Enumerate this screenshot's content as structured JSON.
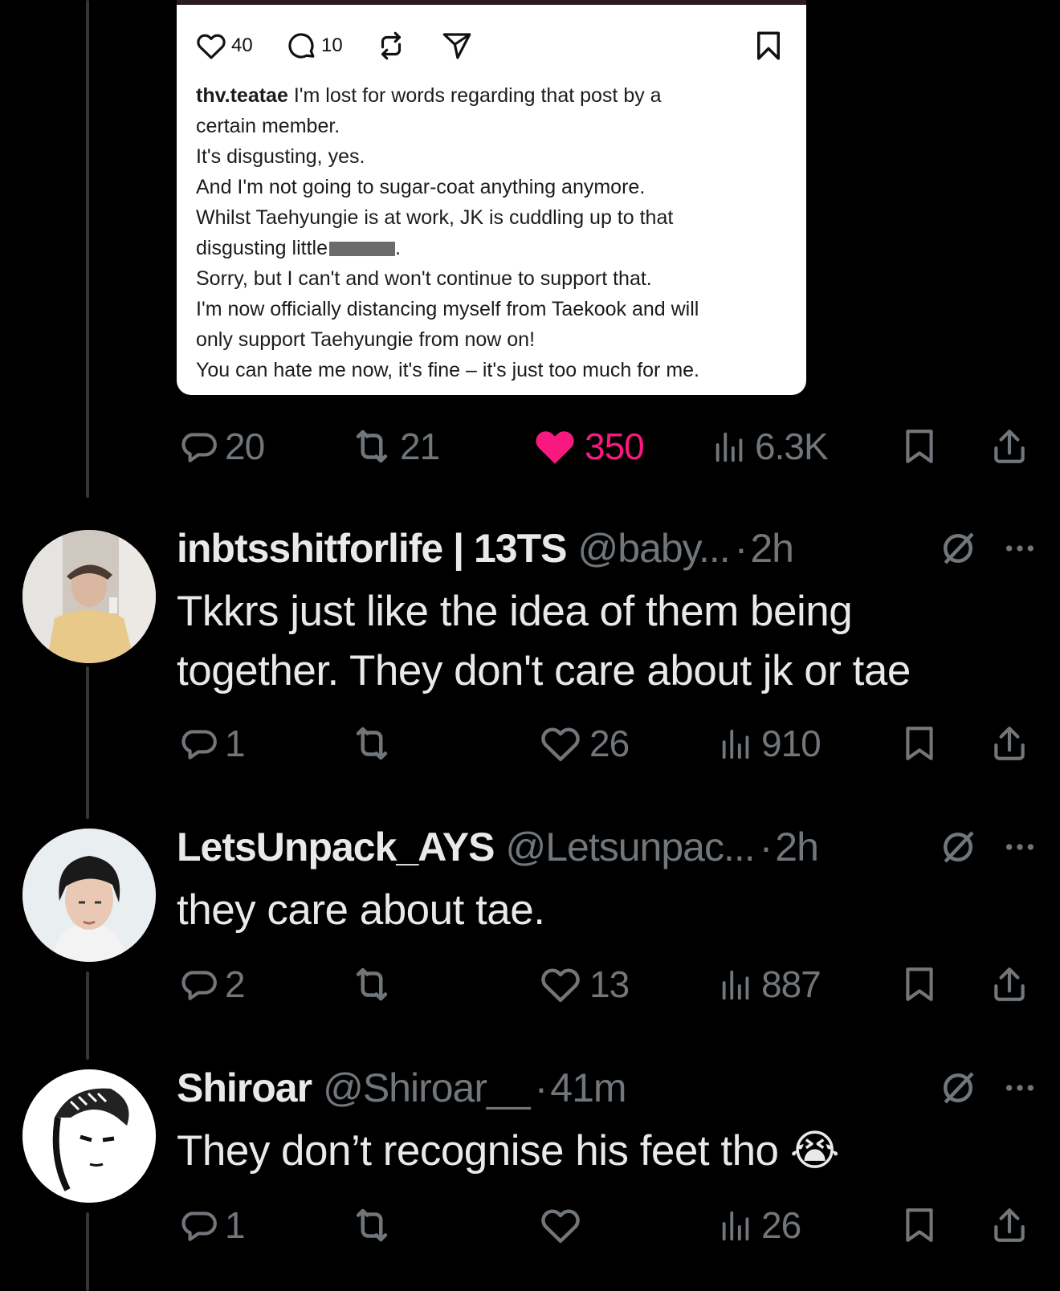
{
  "embed": {
    "likes": "40",
    "comments": "10",
    "username": "thv.teatae",
    "lines": [
      "I'm lost for words regarding that post by a",
      "certain member.",
      "It's disgusting, yes.",
      "And I'm not going to sugar-coat anything anymore.",
      "Whilst  Taehyungie is at work, JK is cuddling up to that",
      "disgusting little",
      "Sorry, but I can't and won't continue to support that.",
      "I'm now officially distancing myself from Taekook and will",
      "only support Taehyungie from now on!",
      "You can hate me now, it's fine – it's just too much for me."
    ],
    "line6_suffix": "."
  },
  "main_post": {
    "replies": "20",
    "reposts": "21",
    "likes": "350",
    "views": "6.3K",
    "like_color": "#f91880"
  },
  "replies": [
    {
      "name": "inbtsshitforlife | 13TS",
      "handle": "@baby...",
      "time": "2h",
      "text_lines": [
        "Tkkrs just like the idea of them being",
        "together. They don't care about jk or tae"
      ],
      "reply_count": "1",
      "repost_count": "",
      "like_count": "26",
      "views": "910"
    },
    {
      "name": "LetsUnpack_AYS",
      "handle": "@Letsunpac...",
      "time": "2h",
      "text_lines": [
        "they care about tae."
      ],
      "reply_count": "2",
      "repost_count": "",
      "like_count": "13",
      "views": "887"
    },
    {
      "name": "Shiroar",
      "handle": "@Shiroar__",
      "time": "41m",
      "text_lines": [
        "They don’t recognise his feet tho"
      ],
      "emoji": "😭",
      "reply_count": "1",
      "repost_count": "",
      "like_count": "",
      "views": "26"
    }
  ],
  "separator": "·",
  "icons": {
    "reply": "comment-bubble-icon",
    "repost": "repost-icon",
    "like": "heart-icon",
    "views": "analytics-icon",
    "bookmark": "bookmark-icon",
    "share": "share-icon",
    "grok": "grok-icon",
    "more": "more-icon"
  }
}
